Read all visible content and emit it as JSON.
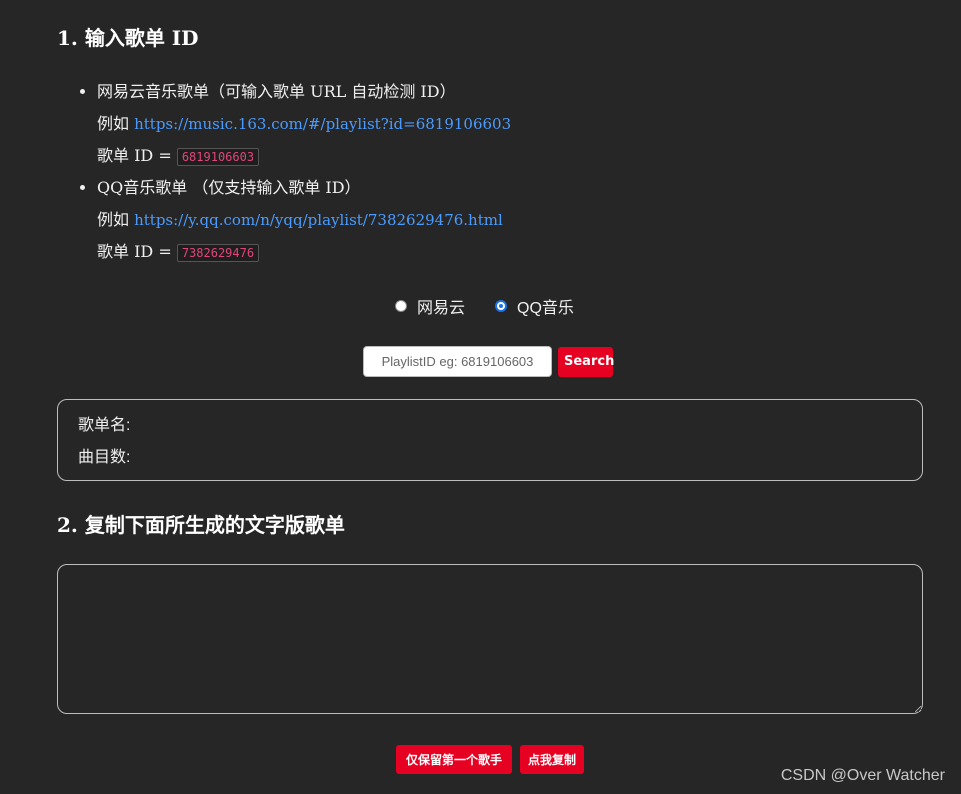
{
  "section1": {
    "title": "1. 输入歌单 ID",
    "sources": [
      {
        "label": "网易云音乐歌单（可输入歌单 URL 自动检测 ID）",
        "example_prefix": "例如",
        "example_url": "https://music.163.com/#/playlist?id=6819106603",
        "id_label": "歌单 ID =",
        "id_value": "6819106603"
      },
      {
        "label": "QQ音乐歌单 （仅支持输入歌单 ID）",
        "example_prefix": "例如",
        "example_url": "https://y.qq.com/n/yqq/playlist/7382629476.html",
        "id_label": "歌单 ID =",
        "id_value": "7382629476"
      }
    ]
  },
  "platform": {
    "options": [
      {
        "label": "网易云",
        "checked": false
      },
      {
        "label": "QQ音乐",
        "checked": true
      }
    ]
  },
  "search": {
    "placeholder": "PlaylistID eg: 6819106603",
    "button_label": "Search"
  },
  "info": {
    "playlist_name_label": "歌单名:",
    "track_count_label": "曲目数:"
  },
  "section2": {
    "title": "2. 复制下面所生成的文字版歌单",
    "output_text": ""
  },
  "actions": {
    "keep_first_artist_label": "仅保留第一个歌手",
    "copy_label": "点我复制"
  },
  "watermark": "CSDN @Over Watcher",
  "colors": {
    "background": "#262626",
    "accent_red": "#e60022",
    "link_blue": "#4a9cff",
    "code_pink": "#e0457b"
  }
}
